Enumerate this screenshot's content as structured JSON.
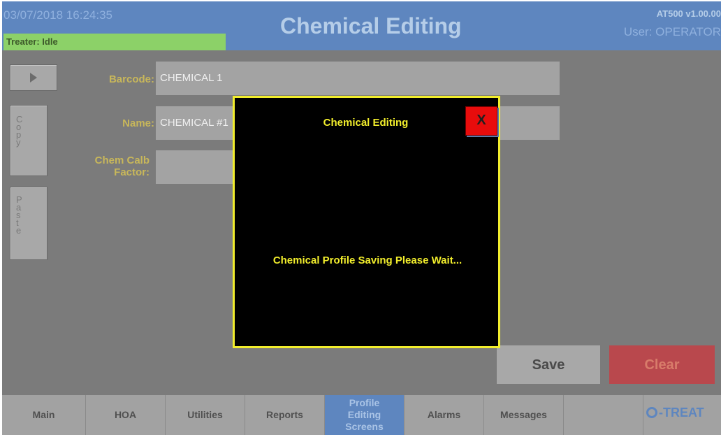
{
  "header": {
    "datetime": "03/07/2018 16:24:35",
    "treater_status": "Treater: Idle",
    "title": "Chemical Editing",
    "version": "AT500 v1.00.00",
    "user": "User: OPERATOR"
  },
  "side": {
    "copy_label": "Copy",
    "paste_label": "Paste"
  },
  "form": {
    "barcode_label": "Barcode:",
    "barcode_value": "CHEMICAL 1",
    "name_label": "Name:",
    "name_value": "CHEMICAL #1",
    "calib_label_line1": "Chem Calb",
    "calib_label_line2": "Factor:",
    "calib_value": ""
  },
  "actions": {
    "save_label": "Save",
    "clear_label": "Clear"
  },
  "nav": {
    "items": [
      {
        "label": "Main"
      },
      {
        "label": "HOA"
      },
      {
        "label": "Utilities"
      },
      {
        "label": "Reports"
      },
      {
        "label_lines": [
          "Profile",
          "Editing",
          "Screens"
        ],
        "active": true
      },
      {
        "label": "Alarms"
      },
      {
        "label": "Messages"
      },
      {
        "label": ""
      }
    ],
    "logo_text": "-TREAT"
  },
  "modal": {
    "title": "Chemical Editing",
    "close_label": "X",
    "message": "Chemical Profile Saving Please Wait..."
  },
  "colors": {
    "header_blue": "#5e86bf",
    "status_green": "#8cd168",
    "modal_border": "#f2ee2c",
    "close_red": "#e80c0c",
    "clear_red": "#b9484d"
  }
}
